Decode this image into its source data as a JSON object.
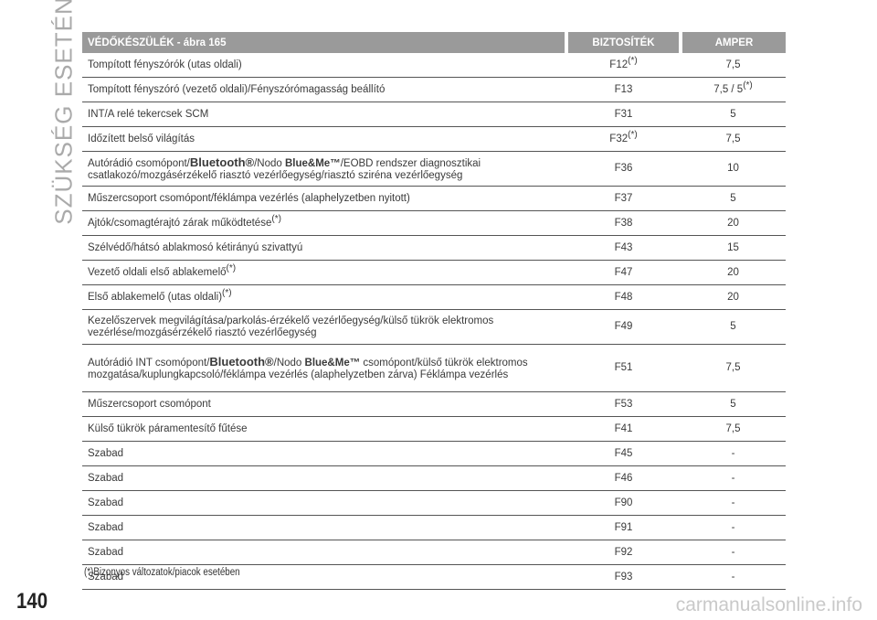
{
  "section_title": "SZÜKSÉG ESETÉN",
  "table": {
    "headers": [
      "VÉDŐKÉSZÜLÉK - ábra 165",
      "BIZTOSÍTÉK",
      "AMPER"
    ],
    "rows": [
      {
        "cls": "r1",
        "device": "Tompított fényszórók (utas oldali)",
        "fuse": "F12",
        "fuse_star": "(*)",
        "amp": "7,5",
        "amp_star": ""
      },
      {
        "cls": "r1",
        "device": "Tompított fényszóró (vezető oldali)/Fényszórómagasság beállító",
        "fuse": "F13",
        "fuse_star": "",
        "amp": "7,5 / 5",
        "amp_star": "(*)"
      },
      {
        "cls": "r1",
        "device": "INT/A relé tekercsek SCM",
        "fuse": "F31",
        "fuse_star": "",
        "amp": "5",
        "amp_star": ""
      },
      {
        "cls": "r1",
        "device": "Időzített belső világítás",
        "fuse": "F32",
        "fuse_star": "(*)",
        "amp": "7,5",
        "amp_star": ""
      },
      {
        "cls": "r2",
        "device": [
          "Autórádió csomópont/",
          "Bluetooth®",
          "/Nodo ",
          "Blue&Me™",
          "/EOBD rendszer diagnosztikai csatlakozó/mozgásérzékelő riasztó vezérlőegység/riasztó sziréna vezérlőegység"
        ],
        "fuse": "F36",
        "fuse_star": "",
        "amp": "10",
        "amp_star": ""
      },
      {
        "cls": "r1",
        "device": "Műszercsoport csomópont/féklámpa vezérlés (alaphelyzetben nyitott)",
        "fuse": "F37",
        "fuse_star": "",
        "amp": "5",
        "amp_star": ""
      },
      {
        "cls": "r1",
        "device": "Ajtók/csomagtérajtó zárak működtetése",
        "device_star": "(*)",
        "fuse": "F38",
        "fuse_star": "",
        "amp": "20",
        "amp_star": ""
      },
      {
        "cls": "r1",
        "device": "Szélvédő/hátsó ablakmosó kétirányú szivattyú",
        "fuse": "F43",
        "fuse_star": "",
        "amp": "15",
        "amp_star": ""
      },
      {
        "cls": "r1",
        "device": "Vezető oldali első ablakemelő",
        "device_star": "(*)",
        "fuse": "F47",
        "fuse_star": "",
        "amp": "20",
        "amp_star": ""
      },
      {
        "cls": "r1",
        "device": "Első ablakemelő (utas oldali)",
        "device_star": "(*)",
        "fuse": "F48",
        "fuse_star": "",
        "amp": "20",
        "amp_star": ""
      },
      {
        "cls": "r2",
        "device": "Kezelőszervek megvilágítása/parkolás-érzékelő vezérlőegység/külső tükrök elektromos vezérlése/mozgásérzékelő riasztó vezérlőegység",
        "fuse": "F49",
        "fuse_star": "",
        "amp": "5",
        "amp_star": ""
      },
      {
        "cls": "r3",
        "device": [
          "Autórádió INT csomópont/",
          "Bluetooth®",
          "/Nodo ",
          "Blue&Me™",
          " csomópont/külső tükrök elektromos mozgatása/kuplungkapcsoló/féklámpa vezérlés (alaphelyzetben zárva) Féklámpa vezérlés"
        ],
        "fuse": "F51",
        "fuse_star": "",
        "amp": "7,5",
        "amp_star": ""
      },
      {
        "cls": "r1",
        "device": "Műszercsoport csomópont",
        "fuse": "F53",
        "fuse_star": "",
        "amp": "5",
        "amp_star": ""
      },
      {
        "cls": "r1",
        "device": "Külső tükrök páramentesítő fűtése",
        "fuse": "F41",
        "fuse_star": "",
        "amp": "7,5",
        "amp_star": ""
      },
      {
        "cls": "r1",
        "device": "Szabad",
        "fuse": "F45",
        "fuse_star": "",
        "amp": "-",
        "amp_star": ""
      },
      {
        "cls": "r1",
        "device": "Szabad",
        "fuse": "F46",
        "fuse_star": "",
        "amp": "-",
        "amp_star": ""
      },
      {
        "cls": "r1",
        "device": "Szabad",
        "fuse": "F90",
        "fuse_star": "",
        "amp": "-",
        "amp_star": ""
      },
      {
        "cls": "r1",
        "device": "Szabad",
        "fuse": "F91",
        "fuse_star": "",
        "amp": "-",
        "amp_star": ""
      },
      {
        "cls": "r1",
        "device": "Szabad",
        "fuse": "F92",
        "fuse_star": "",
        "amp": "-",
        "amp_star": ""
      },
      {
        "cls": "r1",
        "device": "Szabad",
        "fuse": "F93",
        "fuse_star": "",
        "amp": "-",
        "amp_star": ""
      }
    ]
  },
  "footnote": "(*)Bizonyos változatok/piacok esetében",
  "page_number": "140",
  "watermark": "carmanualsonline.info"
}
